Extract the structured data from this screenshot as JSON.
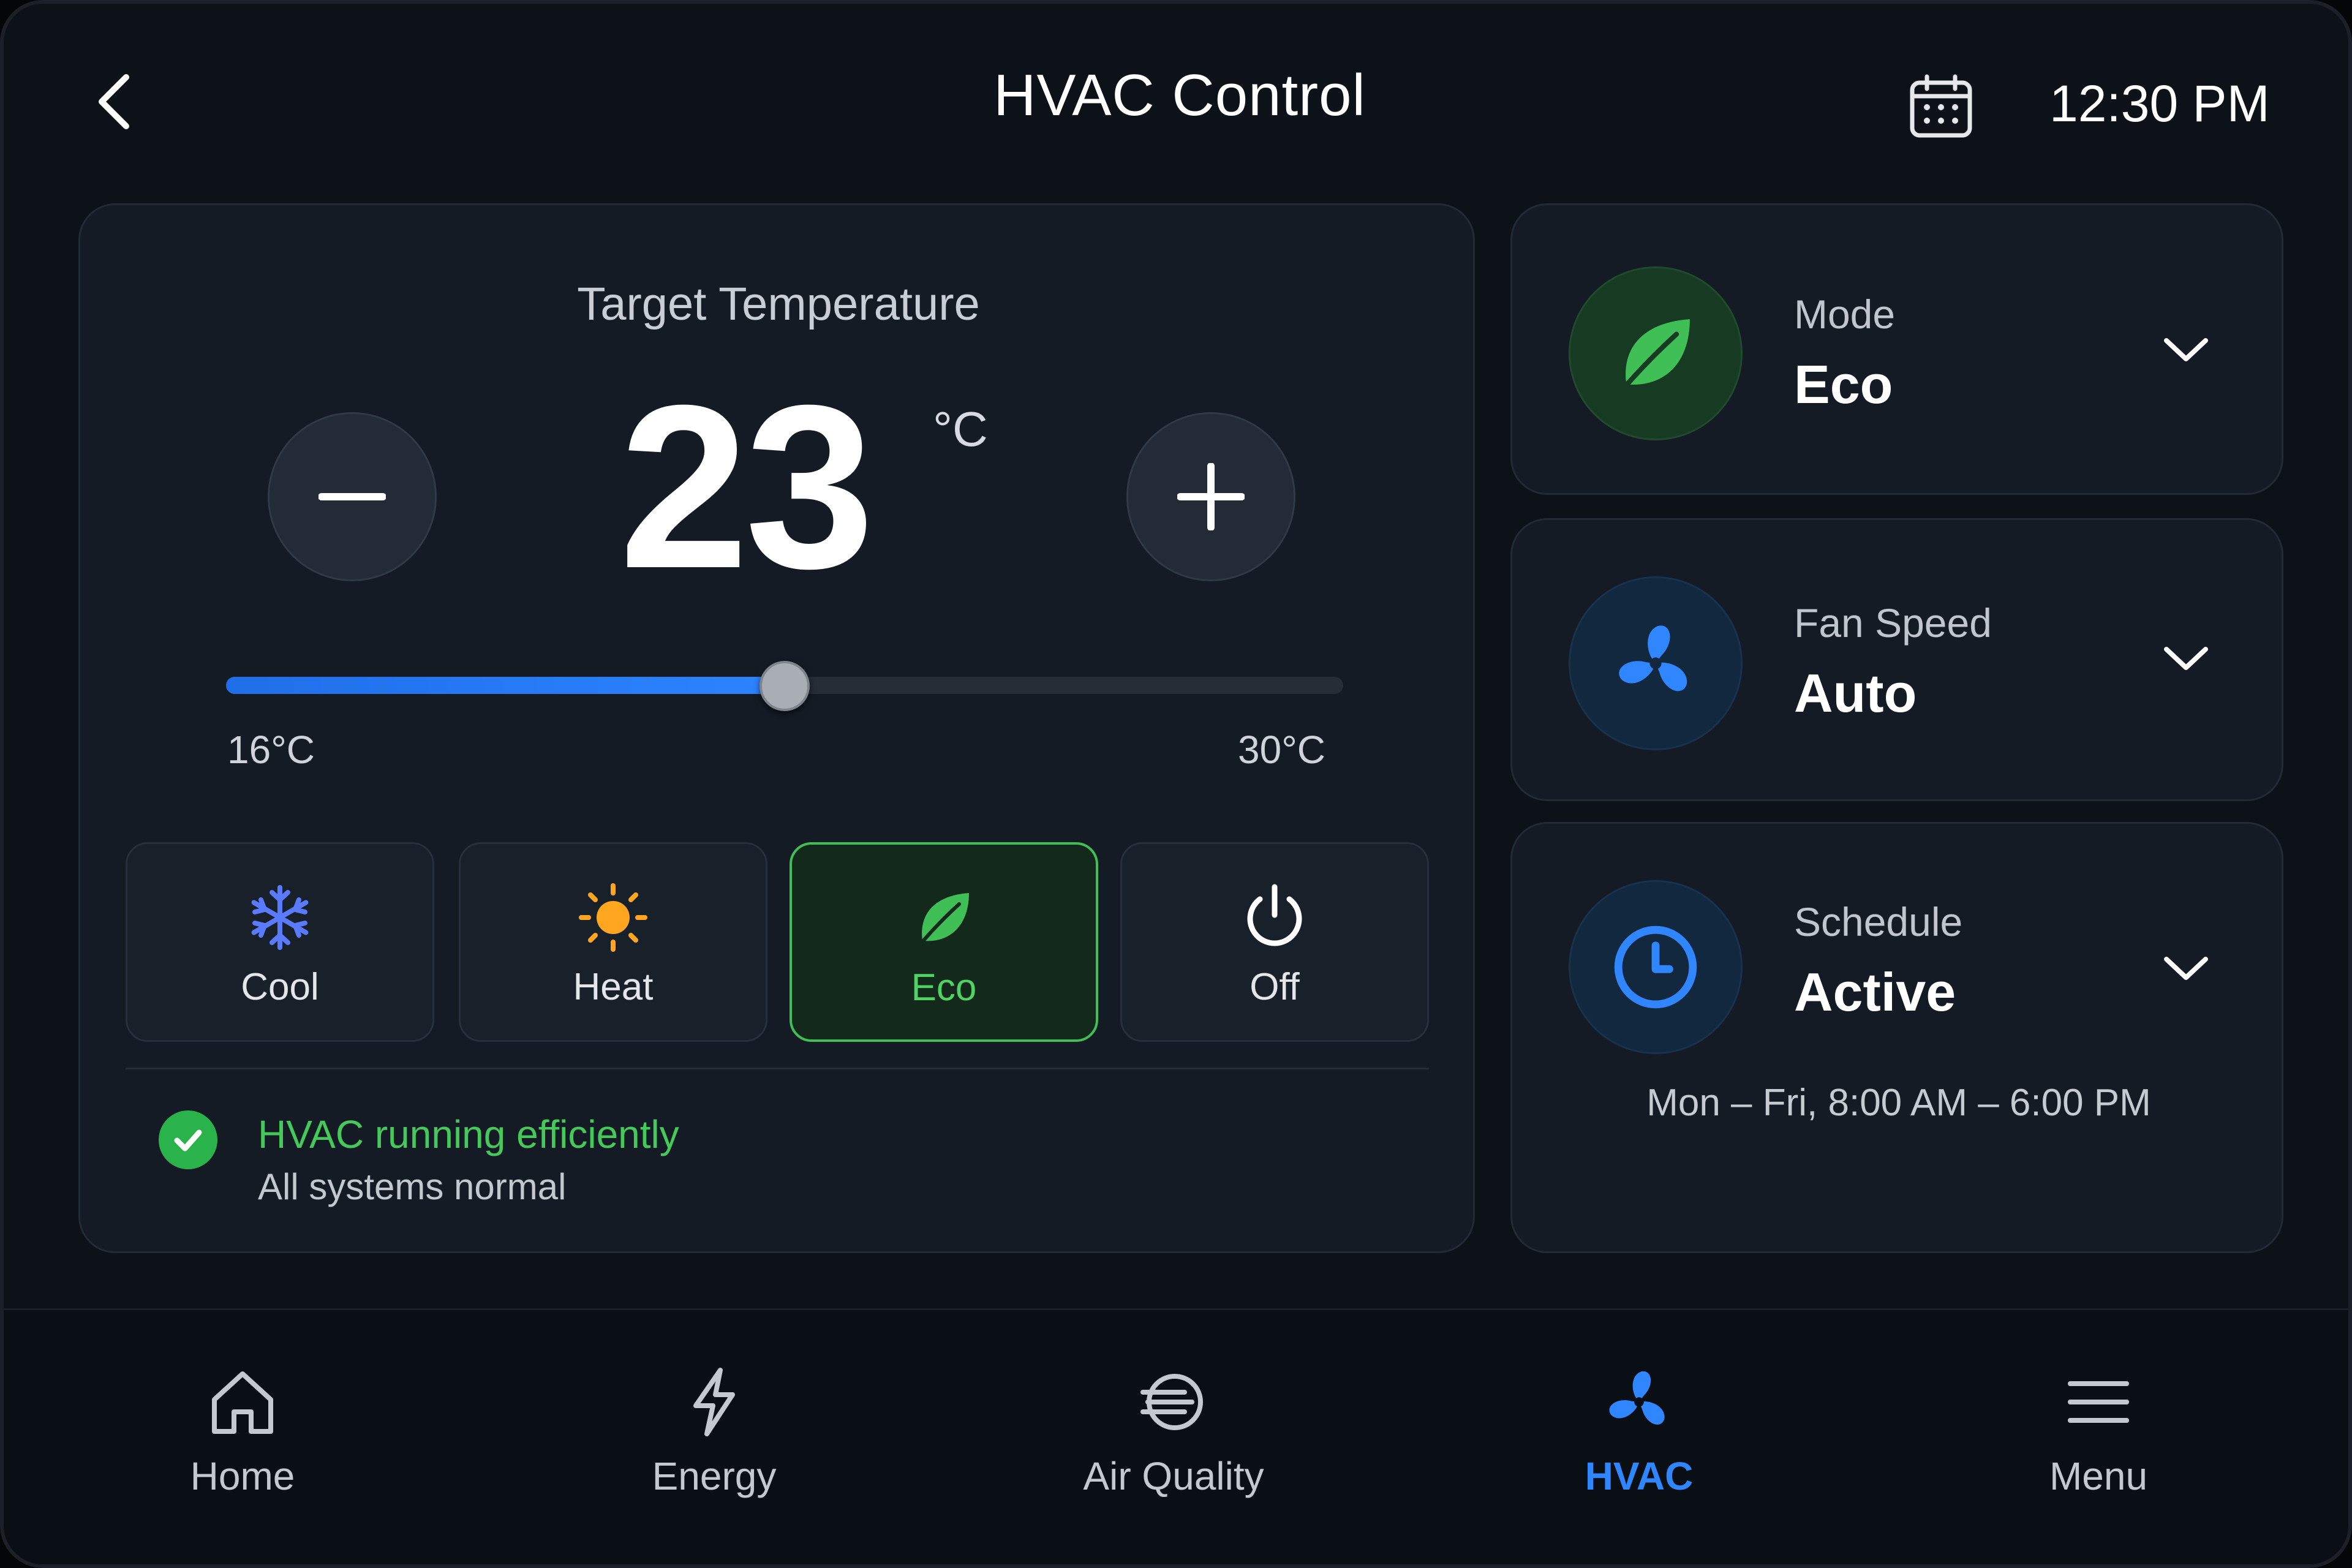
{
  "header": {
    "title": "HVAC Control",
    "time": "12:30 PM",
    "back_icon": "chevron-left-icon",
    "calendar_icon": "calendar-icon"
  },
  "thermostat": {
    "label": "Target Temperature",
    "value": "23",
    "unit": "°C",
    "slider": {
      "min": 16,
      "max": 30,
      "value": 23,
      "min_label": "16°C",
      "max_label": "30°C"
    }
  },
  "modes": [
    {
      "label": "Cool",
      "icon": "snowflake-icon",
      "color": "#5a7bff"
    },
    {
      "label": "Heat",
      "icon": "sun-icon",
      "color": "#ffa51f"
    },
    {
      "label": "Eco",
      "icon": "leaf-icon",
      "color": "#3fbf56",
      "selected": true
    },
    {
      "label": "Off",
      "icon": "power-icon",
      "color": "#ffffff"
    }
  ],
  "status": {
    "title": "HVAC running efficiently",
    "subtitle": "All systems normal"
  },
  "cards": {
    "mode": {
      "label": "Mode",
      "value": "Eco"
    },
    "fan": {
      "label": "Fan Speed",
      "value": "Auto"
    },
    "schedule": {
      "label": "Schedule",
      "value": "Active",
      "detail": "Mon – Fri, 8:00 AM – 6:00 PM"
    }
  },
  "nav": [
    {
      "label": "Home",
      "icon": "home-icon"
    },
    {
      "label": "Energy",
      "icon": "lightning-icon"
    },
    {
      "label": "Air Quality",
      "icon": "air-quality-icon"
    },
    {
      "label": "HVAC",
      "icon": "fan-icon",
      "active": true
    },
    {
      "label": "Menu",
      "icon": "menu-icon"
    }
  ],
  "colors": {
    "accent_blue": "#2f86ff",
    "eco_green": "#3fbf56",
    "background": "#0d1219"
  }
}
